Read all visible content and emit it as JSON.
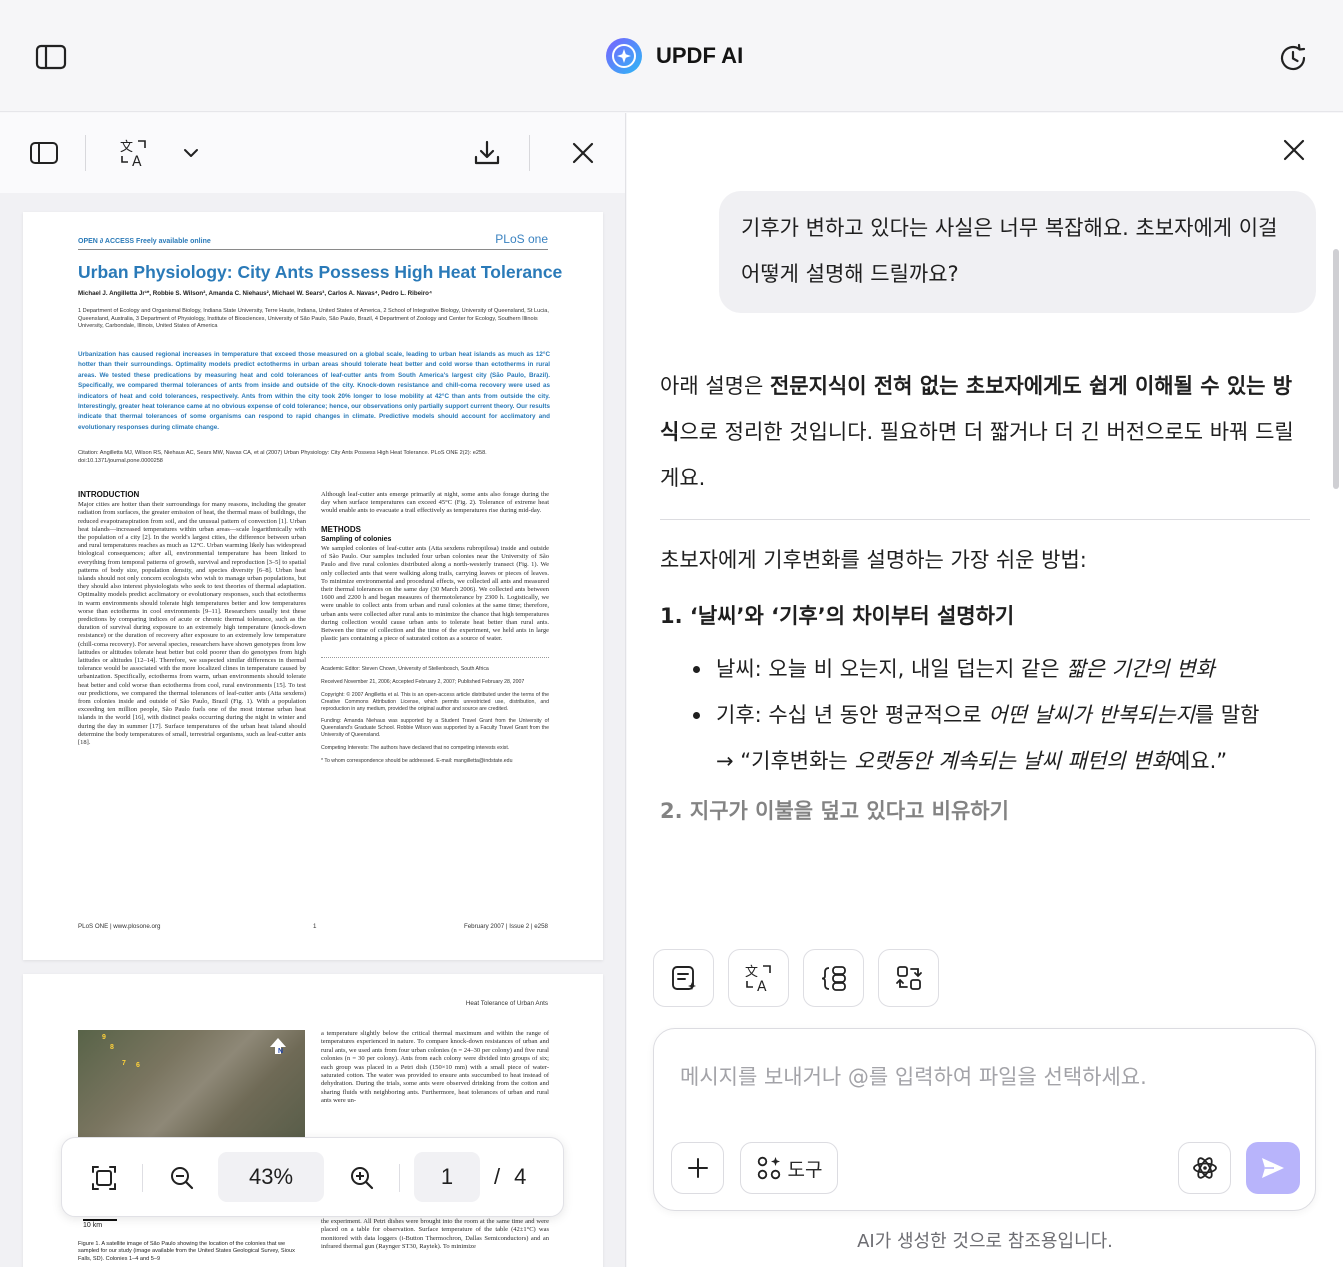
{
  "header": {
    "title": "UPDF AI"
  },
  "viewer": {
    "zoom": "43%",
    "current_page": "1",
    "page_separator": "/",
    "total_pages": "4",
    "document": {
      "open_access": "OPEN ∂ ACCESS Freely available online",
      "journal_logo": "PLoS one",
      "title": "Urban Physiology: City Ants Possess High Heat Tolerance",
      "authors": "Michael J. Angilletta Jr¹*, Robbie S. Wilson², Amanda C. Niehaus², Michael W. Sears³, Carlos A. Navas⁴, Pedro L. Ribeiro⁴",
      "affiliations": "1 Department of Ecology and Organismal Biology, Indiana State University, Terre Haute, Indiana, United States of America, 2 School of Integrative Biology, University of Queensland, St Lucia, Queensland, Australia, 3 Department of Physiology, Institute of Biosciences, University of São Paulo, São Paulo, Brazil, 4 Department of Zoology and Center for Ecology, Southern Illinois University, Carbondale, Illinois, United States of America",
      "abstract": "Urbanization has caused regional increases in temperature that exceed those measured on a global scale, leading to urban heat islands as much as 12°C hotter than their surroundings. Optimality models predict ectotherms in urban areas should tolerate heat better and cold worse than ectotherms in rural areas. We tested these predications by measuring heat and cold tolerances of leaf-cutter ants from South America's largest city (São Paulo, Brazil). Specifically, we compared thermal tolerances of ants from inside and outside of the city. Knock-down resistance and chill-coma recovery were used as indicators of heat and cold tolerances, respectively. Ants from within the city took 20% longer to lose mobility at 42°C than ants from outside the city. Interestingly, greater heat tolerance came at no obvious expense of cold tolerance; hence, our observations only partially support current theory. Our results indicate that thermal tolerances of some organisms can respond to rapid changes in climate. Predictive models should account for acclimatory and evolutionary responses during climate change.",
      "citation": "Citation: Angilletta MJ, Wilson RS, Niehaus AC, Sears MW, Navas CA, et al (2007) Urban Physiology: City Ants Possess High Heat Tolerance. PLoS ONE 2(2): e258. doi:10.1371/journal.pone.0000258",
      "intro_heading": "INTRODUCTION",
      "intro_text": "Major cities are hotter than their surroundings for many reasons, including the greater radiation from surfaces, the greater emission of heat, the thermal mass of buildings, the reduced evapotranspiration from soil, and the unusual pattern of convection [1]. Urban heat islands—increased temperatures within urban areas—scale logarithmically with the population of a city [2]. In the world's largest cities, the difference between urban and rural temperatures reaches as much as 12°C. Urban warming likely has widespread biological consequences; after all, environmental temperature has been linked to everything from temporal patterns of growth, survival and reproduction [3–5] to spatial patterns of body size, population density, and species diversity [6–8]. Urban heat islands should not only concern ecologists who wish to manage urban populations, but they should also interest physiologists who seek to test theories of thermal adaptation. Optimality models predict acclimatory or evolutionary responses, such that ectotherms in warm environments should tolerate high temperatures better and low temperatures worse than ectotherms in cool environments [9–11]. Researchers usually test these predictions by comparing indices of acute or chronic thermal tolerance, such as the duration of survival during exposure to an extremely high temperature (knock-down resistance) or the duration of recovery after exposure to an extremely low temperature (chill-coma recovery). For several species, researchers have shown genotypes from low latitudes or altitudes tolerate heat better but cold poorer than do genotypes from high latitudes or altitudes [12–14]. Therefore, we suspected similar differences in thermal tolerance would be associated with the more localized clines in temperature caused by urbanization. Specifically, ectotherms from warm, urban environments should tolerate heat better and cold worse than ectotherms from cool, rural environments [15]. To test our predictions, we compared the thermal tolerances of leaf-cutter ants (Atta sexdens) from colonies inside and outside of São Paulo, Brazil (Fig. 1). With a population exceeding ten million people, São Paulo fuels one of the most intense urban heat islands in the world [16], with distinct peaks occurring during the night in winter and during the day in summer [17]. Surface temperatures of the urban heat island should determine the body temperatures of small, terrestrial organisms, such as leaf-cutter ants [18].",
      "right_text": "Although leaf-cutter ants emerge primarily at night, some ants also forage during the day when surface temperatures can exceed 45°C (Fig. 2). Tolerance of extreme heat would enable ants to evacuate a trail effectively as temperatures rise during mid-day.",
      "methods_heading": "METHODS",
      "sampling_heading": "Sampling of colonies",
      "methods_text": "We sampled colonies of leaf-cutter ants (Atta sexdens rubropilosa) inside and outside of São Paulo. Our samples included four urban colonies near the University of São Paulo and five rural colonies distributed along a north-westerly transect (Fig. 1). We only collected ants that were walking along trails, carrying leaves or pieces of leaves. To minimize environmental and procedural effects, we collected all ants and measured their thermal tolerances on the same day (30 March 2006). We collected ants between 1600 and 2200 h and began measures of thermotolerance by 2300 h. Logistically, we were unable to collect ants from urban and rural colonies at the same time; therefore, urban ants were collected after rural ants to minimize the chance that high temperatures during collection would cause urban ants to tolerate heat better than rural ants. Between the time of collection and the time of the experiment, we held ants in large plastic jars containing a piece of saturated cotton as a source of water.",
      "editor": "Academic Editor: Steven Chown, University of Stellenbosch, South Africa",
      "received": "Received November 21, 2006; Accepted February 2, 2007; Published February 28, 2007",
      "copyright": "Copyright: © 2007 Angilletta et al. This is an open-access article distributed under the terms of the Creative Commons Attribution License, which permits unrestricted use, distribution, and reproduction in any medium, provided the original author and source are credited.",
      "funding": "Funding: Amanda Niehaus was supported by a Student Travel Grant from the University of Queensland's Graduate School. Robbie Wilson was supported by a Faculty Travel Grant from the University of Queensland.",
      "competing": "Competing Interests: The authors have declared that no competing interests exist.",
      "correspondence": "* To whom correspondence should be addressed. E-mail: mangilletta@indstate.edu",
      "footer_left": "PLoS ONE | www.plosone.org",
      "footer_mid": "1",
      "footer_right": "February 2007 | Issue 2 | e258",
      "page2_header": "Heat Tolerance of Urban Ants",
      "page2_text": "a temperature slightly below the critical thermal maximum and within the range of temperatures experienced in nature. To compare knock-down resistances of urban and rural ants, we used ants from four urban colonies (n = 24–30 per colony) and five rural colonies (n = 30 per colony). Ants from each colony were divided into groups of six; each group was placed in a Petri dish (150×10 mm) with a small piece of water-saturated cotton. The water was provided to ensure ants succumbed to heat instead of dehydration. During the trials, some ants were observed drinking from the cotton and sharing fluids with neighboring ants. Furthermore, heat tolerances of urban and rural ants were un-",
      "page2_text2": "the experiment. All Petri dishes were brought into the room at the same time and were placed on a table for observation. Surface temperature of the table (42±1°C) was monitored with data loggers (i-Button Thermochron, Dallas Semiconductors) and an infrared thermal gun (Raynger ST30, Raytek). To minimize",
      "map_scale": "10 km",
      "map_marks": [
        "9",
        "8",
        "7",
        "6",
        "N"
      ],
      "figure_caption": "Figure 1. A satellite image of São Paulo showing the location of the colonies that we sampled for our study (image available from the United States Geological Survey, Sioux Falls, SD). Colonies 1–4 and 5–9"
    }
  },
  "chat": {
    "user_message": "기후가 변하고 있다는 사실은 너무 복잡해요. 초보자에게 이걸 어떻게 설명해 드릴까요?",
    "ai_lead_pre": "아래 설명은 ",
    "ai_lead_bold": "전문지식이 전혀 없는 초보자에게도 쉽게 이해될 수 있는 방식",
    "ai_lead_post": "으로 정리한 것입니다. 필요하면 더 짧거나 더 긴 버전으로도 바꿔 드릴게요.",
    "ai_intro": "초보자에게 기후변화를 설명하는 가장 쉬운 방법:",
    "step1": "1.  ‘날씨’와 ‘기후’의 차이부터 설명하기",
    "bullet1_pre": "날씨: 오늘 비 오는지, 내일 덥는지 같은 ",
    "bullet1_em": "짧은 기간의 변화",
    "bullet2_pre": "기후: 수십 년 동안 평균적으로 ",
    "bullet2_em": "어떤 날씨가 반복되는지",
    "bullet2_post": "를 말함",
    "quote_pre": "→  “기후변화는 ",
    "quote_em": "오랫동안 계속되는 날씨 패턴의 변화",
    "quote_post": "예요.”",
    "step2_partial": "2. 지구가 이불을 덮고 있다고 비유하기",
    "input_placeholder": "메시지를 보내거나 @를 입력하여 파일을 선택하세요.",
    "tools_label": "도구",
    "disclaimer": "AI가 생성한 것으로 참조용입니다."
  },
  "colors": {
    "accent": "#2a7ab8",
    "send": "#b8b4fb",
    "brand": "#4b6cf7"
  }
}
